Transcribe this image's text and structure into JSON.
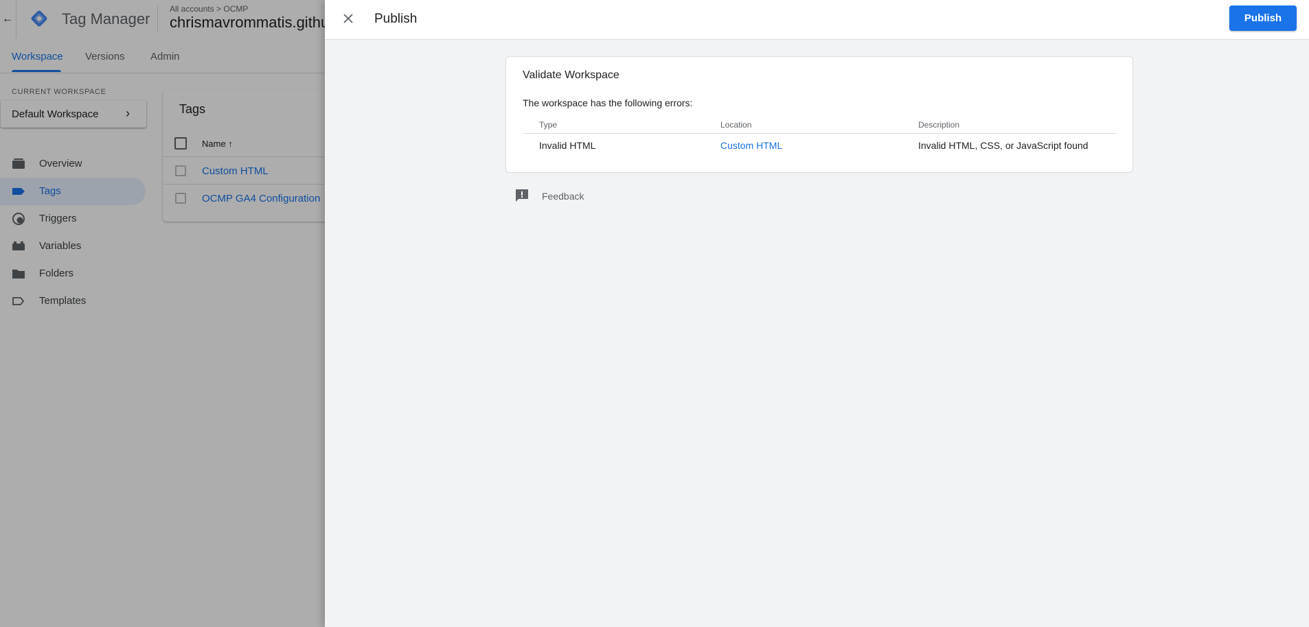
{
  "app": {
    "product_name": "Tag Manager",
    "breadcrumb": "All accounts > OCMP",
    "container_name": "chrismavrommatis.github.io",
    "back_icon": "arrow-left-icon"
  },
  "tabs": [
    {
      "label": "Workspace",
      "active": true
    },
    {
      "label": "Versions",
      "active": false
    },
    {
      "label": "Admin",
      "active": false
    }
  ],
  "sidebar": {
    "current_workspace_label": "CURRENT WORKSPACE",
    "workspace_name": "Default Workspace",
    "items": [
      {
        "label": "Overview",
        "icon": "overview-icon",
        "active": false
      },
      {
        "label": "Tags",
        "icon": "tag-icon",
        "active": true
      },
      {
        "label": "Triggers",
        "icon": "trigger-icon",
        "active": false
      },
      {
        "label": "Variables",
        "icon": "variables-icon",
        "active": false
      },
      {
        "label": "Folders",
        "icon": "folder-icon",
        "active": false
      },
      {
        "label": "Templates",
        "icon": "template-icon",
        "active": false
      }
    ]
  },
  "tags_card": {
    "title": "Tags",
    "column_name": "Name",
    "rows": [
      "Custom HTML",
      "OCMP GA4 Configuration"
    ]
  },
  "publish_panel": {
    "title": "Publish",
    "publish_button": "Publish",
    "close_icon": "close-icon",
    "validate": {
      "title": "Validate Workspace",
      "message": "The workspace has the following errors:",
      "columns": [
        "Type",
        "Location",
        "Description"
      ],
      "rows": [
        {
          "type": "Invalid HTML",
          "location": "Custom HTML",
          "description": "Invalid HTML, CSS, or JavaScript found"
        }
      ]
    },
    "feedback_label": "Feedback",
    "feedback_icon": "feedback-icon"
  },
  "colors": {
    "accent": "#1a73e8",
    "panel_bg": "#f1f3f4",
    "scrim": "rgba(0,0,0,0.32)"
  }
}
